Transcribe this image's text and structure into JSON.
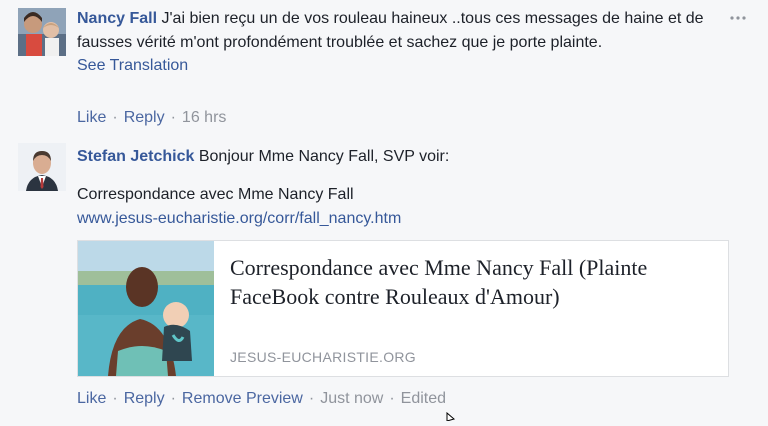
{
  "comment1": {
    "author": "Nancy Fall",
    "text": "J'ai bien reçu un de vos rouleau haineux ..tous ces messages de haine et de fausses vérité m'ont profondément troublée et sachez que je porte plainte.",
    "see_translation": "See Translation",
    "actions": {
      "like": "Like",
      "reply": "Reply",
      "time": "16 hrs",
      "sep": "·"
    },
    "more_icon": "more-horizontal-icon"
  },
  "comment2": {
    "author": "Stefan Jetchick",
    "text_line1": "Bonjour Mme Nancy Fall, SVP voir:",
    "text_line2": "Correspondance avec Mme Nancy Fall",
    "url": "www.jesus-eucharistie.org/corr/fall_nancy.htm",
    "preview": {
      "title": "Correspondance avec Mme Nancy Fall (Plainte FaceBook contre Rouleaux d'Amour)",
      "domain": "JESUS-EUCHARISTIE.ORG"
    },
    "actions": {
      "like": "Like",
      "reply": "Reply",
      "remove_preview": "Remove Preview",
      "time": "Just now",
      "edited": "Edited",
      "sep": "·"
    }
  },
  "colors": {
    "link": "#365899",
    "meta": "#90949c",
    "background": "#f6f7f9"
  }
}
